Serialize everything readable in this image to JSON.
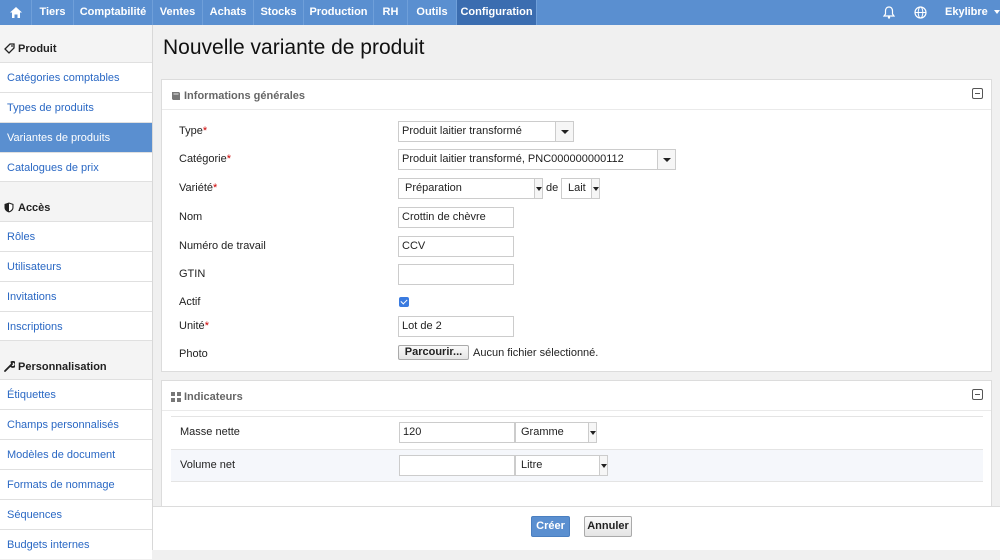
{
  "nav": {
    "items": [
      "Tiers",
      "Comptabilité",
      "Ventes",
      "Achats",
      "Stocks",
      "Production",
      "RH",
      "Outils",
      "Configuration"
    ],
    "active": "Configuration",
    "user": "Ekylibre"
  },
  "sidebar": {
    "sections": [
      {
        "title": "Produit",
        "icon": "tag-icon",
        "items": [
          "Catégories comptables",
          "Types de produits",
          "Variantes de produits",
          "Catalogues de prix"
        ]
      },
      {
        "title": "Accès",
        "icon": "shield-icon",
        "items": [
          "Rôles",
          "Utilisateurs",
          "Invitations",
          "Inscriptions"
        ]
      },
      {
        "title": "Personnalisation",
        "icon": "wrench-icon",
        "items": [
          "Étiquettes",
          "Champs personnalisés",
          "Modèles de document",
          "Formats de nommage",
          "Séquences",
          "Budgets internes"
        ]
      }
    ],
    "active_item": "Variantes de produits"
  },
  "page": {
    "title": "Nouvelle variante de produit"
  },
  "general": {
    "title": "Informations générales",
    "type_label": "Type",
    "type_value": "Produit laitier transformé",
    "category_label": "Catégorie",
    "category_value": "Produit laitier transformé, PNC000000000112",
    "variety_label": "Variété",
    "variety_value": "Préparation",
    "variety_of": "de",
    "variety_derivative": "Lait",
    "name_label": "Nom",
    "name_value": "Crottin de chèvre",
    "work_number_label": "Numéro de travail",
    "work_number_value": "CCV",
    "gtin_label": "GTIN",
    "gtin_value": "",
    "active_label": "Actif",
    "active_checked": true,
    "unit_label": "Unité",
    "unit_value": "Lot de 2",
    "photo_label": "Photo",
    "browse_label": "Parcourir...",
    "no_file": "Aucun fichier sélectionné.",
    "required_mark": "*"
  },
  "indicators": {
    "title": "Indicateurs",
    "rows": [
      {
        "label": "Masse nette",
        "value": "120",
        "unit": "Gramme"
      },
      {
        "label": "Volume net",
        "value": "",
        "unit": "Litre"
      }
    ]
  },
  "actions": {
    "create": "Créer",
    "cancel": "Annuler"
  },
  "colors": {
    "nav": "#5a8fd0",
    "nav_active": "#3b6db0",
    "link": "#2a68c4",
    "required": "#cc0000"
  }
}
